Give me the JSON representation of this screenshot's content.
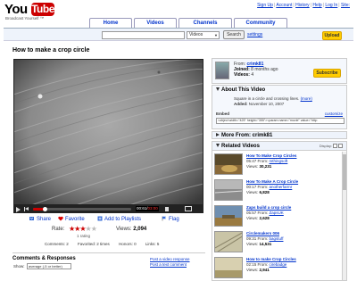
{
  "header": {
    "logo_you": "You",
    "logo_tube": "Tube",
    "slogan": "Broadcast Yourself ™",
    "links": [
      "Sign Up",
      "Account",
      "History",
      "Help",
      "Log In",
      "Site:"
    ],
    "tabs": [
      "Home",
      "Videos",
      "Channels",
      "Community"
    ]
  },
  "search": {
    "query": "",
    "category": "Videos",
    "button_label": "Search",
    "settings_label": "settings",
    "upload_label": "Upload"
  },
  "video": {
    "title": "How to make a crop circle",
    "time_current": "00:61",
    "time_total": "03:00",
    "progress": 0.12
  },
  "actions": {
    "share": "Share",
    "favorite": "Favorite",
    "add_to_playlists": "Add to Playlists",
    "flag": "Flag"
  },
  "rating": {
    "label": "Rate:",
    "stars": 3,
    "max_stars": 5,
    "count_text": "1 rating",
    "views_label": "Views:",
    "views_value": "2,094"
  },
  "stats": {
    "comments": "Comments: 2",
    "favorited": "Favorited: 2 times",
    "honors": "Honors: 0",
    "links": "Links: 5"
  },
  "comments": {
    "title": "Comments & Responses",
    "post_video": "Post a video response",
    "post_text": "Post a text comment",
    "show_label": "Show:",
    "filter": "average (-5 or better)"
  },
  "uploader": {
    "from_label": "From:",
    "name": "crimk81",
    "joined_label": "Joined:",
    "joined_value": "8 months ago",
    "videos_label": "Videos:",
    "videos_value": "4",
    "subscribe_label": "Subscribe"
  },
  "about": {
    "title": "About This Video",
    "description": "Square in a circle and crossing lines.",
    "more_label": "(more)",
    "added_label": "Added:",
    "added_value": "November 10, 2007",
    "embed_label": "Embed",
    "customize_label": "customize",
    "embed_code": "<object width=\"425\" height=\"355\"><param name=\"movie\" value=\"http:"
  },
  "more_from": {
    "title": "More From: crimk81"
  },
  "related": {
    "title": "Related Videos",
    "display_label": "Display:",
    "items": [
      {
        "title": "How To Make Crop Circles",
        "time": "05:47",
        "from_label": "From:",
        "from": "mthingsoft",
        "views_label": "Views:",
        "views": "30,231"
      },
      {
        "title": "How To Make A Crop Circle",
        "time": "00:17",
        "from_label": "From:",
        "from": "anotherfarmr",
        "views_label": "Views:",
        "views": "6,828"
      },
      {
        "title": "Zaps build a crop circle",
        "time": "05:57",
        "from_label": "From:",
        "from": "ZapsUK",
        "views_label": "Views:",
        "views": "2,628"
      },
      {
        "title": "Circlemakers 006",
        "time": "09:31",
        "from_label": "From:",
        "from": "bagstuff",
        "views_label": "Views:",
        "views": "14,531"
      },
      {
        "title": "How to make Crop Circles",
        "time": "02:15",
        "from_label": "From:",
        "from": "cirebadge",
        "views_label": "Views:",
        "views": "2,941"
      }
    ]
  }
}
